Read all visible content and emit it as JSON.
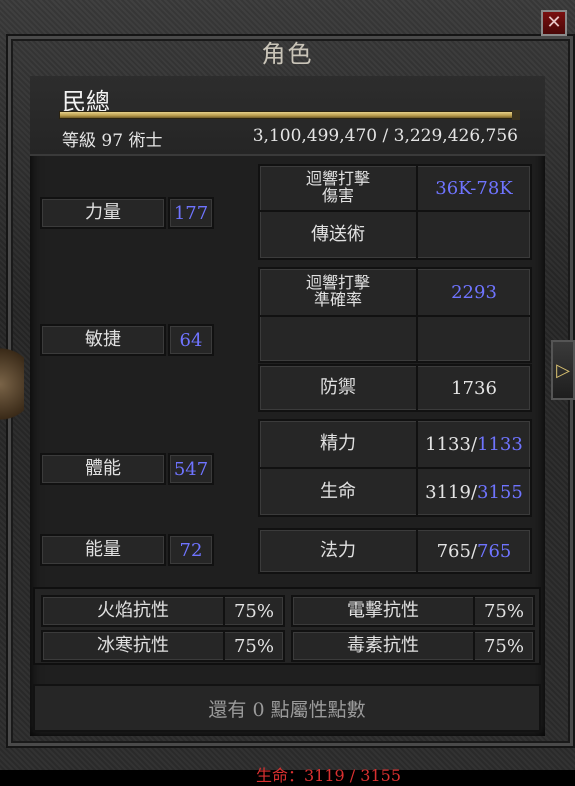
{
  "window": {
    "title": "角色",
    "close_symbol": "✕"
  },
  "character": {
    "name": "民總",
    "level_class": "等級 97 術士",
    "experience": "3,100,499,470 / 3,229,426,756",
    "experience_fraction": 0.96
  },
  "attributes": [
    {
      "label": "力量",
      "value": "177"
    },
    {
      "label": "敏捷",
      "value": "64"
    },
    {
      "label": "體能",
      "value": "547"
    },
    {
      "label": "能量",
      "value": "72"
    }
  ],
  "skill_stats": {
    "right_damage_label": "迴響打擊\n傷害",
    "right_damage_value": "36K-78K",
    "left_skill_label": "傳送術",
    "left_skill_value": "",
    "attack_rating_label": "迴響打擊\n準確率",
    "attack_rating_value": "2293",
    "defense_label": "防禦",
    "defense_value": "1736"
  },
  "vitals": {
    "stamina_label": "精力",
    "stamina_current": "1133",
    "stamina_max": "1133",
    "life_label": "生命",
    "life_current": "3119",
    "life_max": "3155",
    "mana_label": "法力",
    "mana_current": "765",
    "mana_max": "765",
    "separator": "/"
  },
  "resistances": {
    "fire_label": "火焰抗性",
    "fire_value": "75%",
    "lightning_label": "電擊抗性",
    "lightning_value": "75%",
    "cold_label": "冰寒抗性",
    "cold_value": "75%",
    "poison_label": "毒素抗性",
    "poison_value": "75%"
  },
  "footer": {
    "remaining_points": "還有 0 點屬性點數"
  },
  "underlay": {
    "life_text": "生命：3119 / 3155"
  },
  "side": {
    "arrow_symbol": "▷"
  },
  "colors": {
    "stat_blue": "#6f74ff",
    "xp_gold": "#d9bd6a",
    "close_red": "#7a1010"
  }
}
